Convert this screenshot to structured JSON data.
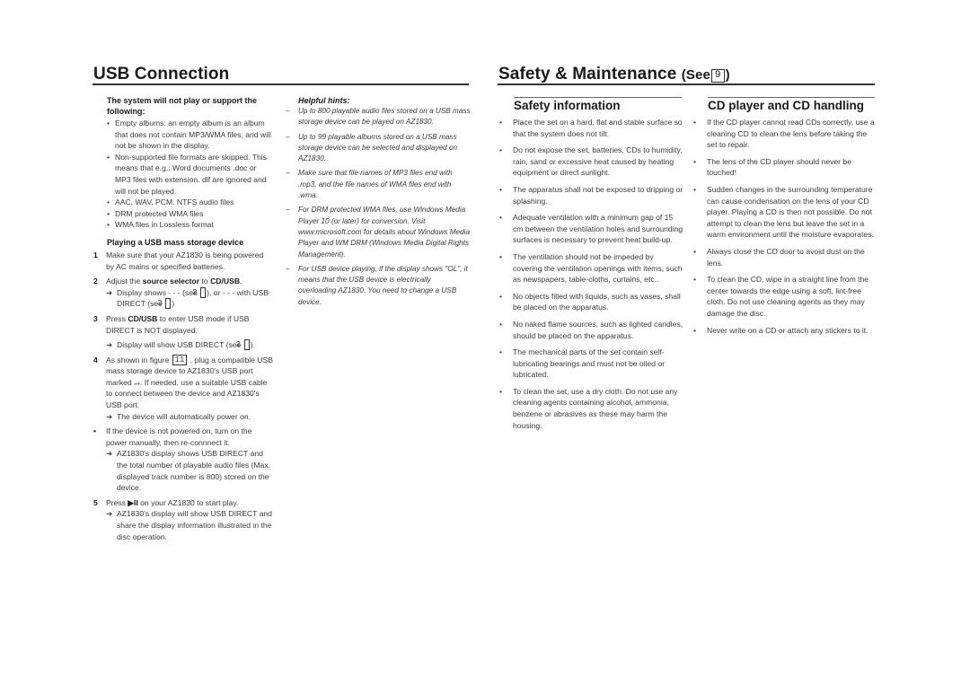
{
  "left": {
    "title": "USB Connection",
    "not_supported": {
      "heading": "The system will not play or support the following:",
      "items": [
        "Empty albums: an empty album is an album that does not contain MP3/WMA files, and will not be shown in the display.",
        "Non-supported file formats are skipped. This means that e.g.: Word documents .doc or MP3 files with extension. dlf are ignored and will not be played.",
        "AAC, WAV, PCM. NTFS audio files",
        "DRM protected WMA files",
        "WMA files in Lossless format"
      ]
    },
    "playing": {
      "heading": "Playing a USB mass storage device",
      "steps": [
        {
          "num": "1",
          "text": "Make sure that your AZ1830 is being powered by AC mains or specified batteries."
        },
        {
          "num": "2",
          "pre": "Adjust the ",
          "bold1": "source selector",
          "mid": " to ",
          "bold2": "CD/USB",
          "post": ".",
          "arrow_pre": "Display shows - - - (see ",
          "fig_a": "2",
          "arrow_mid": "), or - - - with USB DIRECT (see ",
          "fig_b": "3",
          "arrow_post": ")"
        },
        {
          "num": "3",
          "pre": "Press ",
          "bold1": "CD/USB",
          "post": " to enter USB mode if USB DIRECT is NOT displayed.",
          "arrow_pre": "Display will show USB DIRECT (see ",
          "fig_a": "2",
          "arrow_post": ")."
        },
        {
          "num": "4",
          "pre": "As shown in figure ",
          "fig": "11",
          "post": " , plug a compatible USB mass storage device to AZ1830's USB port marked ⭌. If needed, use a suitable USB cable to connect between the device and AZ1830's USB port.",
          "arrow": "The device will automatically power on."
        },
        {
          "num": "•",
          "text": "If the device is not powered on, turn on the power manually, then re-connnect it.",
          "arrow": "AZ1830's display shows USB DIRECT and the total number of playable audio files (Max. displayed track number is 800) stored on the device."
        },
        {
          "num": "5",
          "pre": "Press ",
          "icon": "▶II",
          "post": " on your AZ1830 to start play.",
          "arrow": "AZ1830's display will show USB DIRECT and share the display information illustrated in the disc operation."
        }
      ]
    },
    "hints": {
      "heading": "Helpful hints:",
      "items": [
        "Up to 800 playable audio files stored on a USB mass storage device can be played on AZ1830.",
        "Up to 99 playable albums stored on a USB mass storage device can be selected and displayed on AZ1830.",
        "Make sure that file names of MP3 files end with .mp3. and the file names of WMA files end with .wma.",
        "For DRM protected WMA files, use Windows Media Player 10 (or later) for conversion. Visit www.microsoft.com for details about Windows Media Player and WM DRM (Windows Media Digital Rights Management).",
        "For USB device playing, if the display shows \"OL\", it means that the USB device is electrically overloading AZ1830. You need to change a USB device."
      ]
    }
  },
  "right": {
    "title": "Safety & Maintenance",
    "see_label": "(See",
    "see_fig": "9",
    "see_close": ")",
    "safety": {
      "heading": "Safety information",
      "items": [
        "Place the set on a hard, flat and stable surface so that the system does not tilt.",
        "Do not expose the set, batteries, CDs to humidity, rain, sand or excessive heat caused by heating equipment or direct sunlight.",
        "The apparatus shall not be exposed to dripping or splashing.",
        "Adequate ventilation with a minimum gap of 15 cm between the ventilation holes and surrounding surfaces is necessary to prevent heat build-up.",
        "The ventilation should not be impeded by covering the ventilation openings with items, such as newspapers, table-cloths, curtains, etc..",
        "No objects filled with liquids, such as vases, shall be placed on the apparatus.",
        "No naked flame sources, such as lighted candles, should be placed on the apparatus.",
        "The mechanical parts of the set contain self-lubricating bearings and must not be oiled or lubricated.",
        "To clean the set, use a dry cloth. Do not use any cleaning agents containing alcohol, ammonia, benzene or abrasives as these may harm the housing."
      ]
    },
    "cd": {
      "heading": "CD player and CD handling",
      "items": [
        "If the CD player cannot read CDs correctly, use a cleaning CD to clean the lens before taking the set to repair.",
        "The lens of the CD player should never be touched!",
        "Sudden changes in the surrounding temperature can cause condensation on the lens of your CD player. Playing a CD is then not possible. Do not attempt to clean the lens but leave the set in a warm environment until the moisture evaporates.",
        "Always close the CD door to avoid dust on the lens.",
        "To clean the CD, wipe in a straight line from the center towards the edge using a soft, lint-free cloth. Do not use cleaning agents as they may damage the disc.",
        "Never write on a CD or attach any stickers to it."
      ]
    }
  }
}
